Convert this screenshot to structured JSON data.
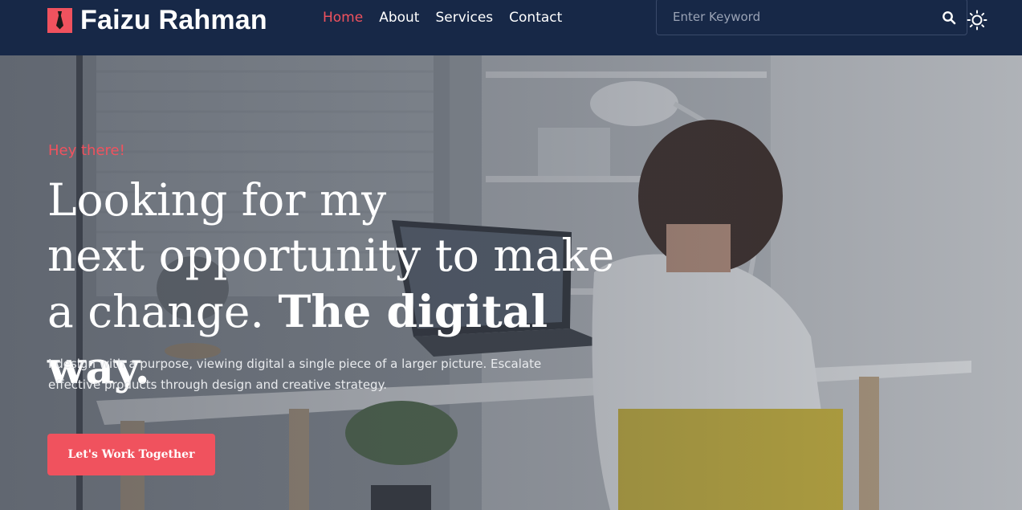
{
  "header": {
    "brand_name": "Faizu Rahman",
    "nav": [
      {
        "label": "Home",
        "active": true
      },
      {
        "label": "About",
        "active": false
      },
      {
        "label": "Services",
        "active": false
      },
      {
        "label": "Contact",
        "active": false
      }
    ],
    "search": {
      "placeholder": "Enter Keyword",
      "value": ""
    },
    "icons": {
      "logo": "tie-logo-icon",
      "search": "search-icon",
      "theme": "sun-icon"
    }
  },
  "hero": {
    "eyebrow": "Hey there!",
    "headline_line1": "Looking for my",
    "headline_line2": "next opportunity to make",
    "headline_line3_regular": "a change. ",
    "headline_line3_bold": "The digital way.",
    "description": "I design with a purpose, viewing digital a single piece of a larger picture. Escalate effective products through design and creative strategy.",
    "cta_label": "Let's Work Together"
  },
  "colors": {
    "accent": "#f0525e",
    "header_bg": "#172847",
    "text_light": "#ffffff"
  }
}
